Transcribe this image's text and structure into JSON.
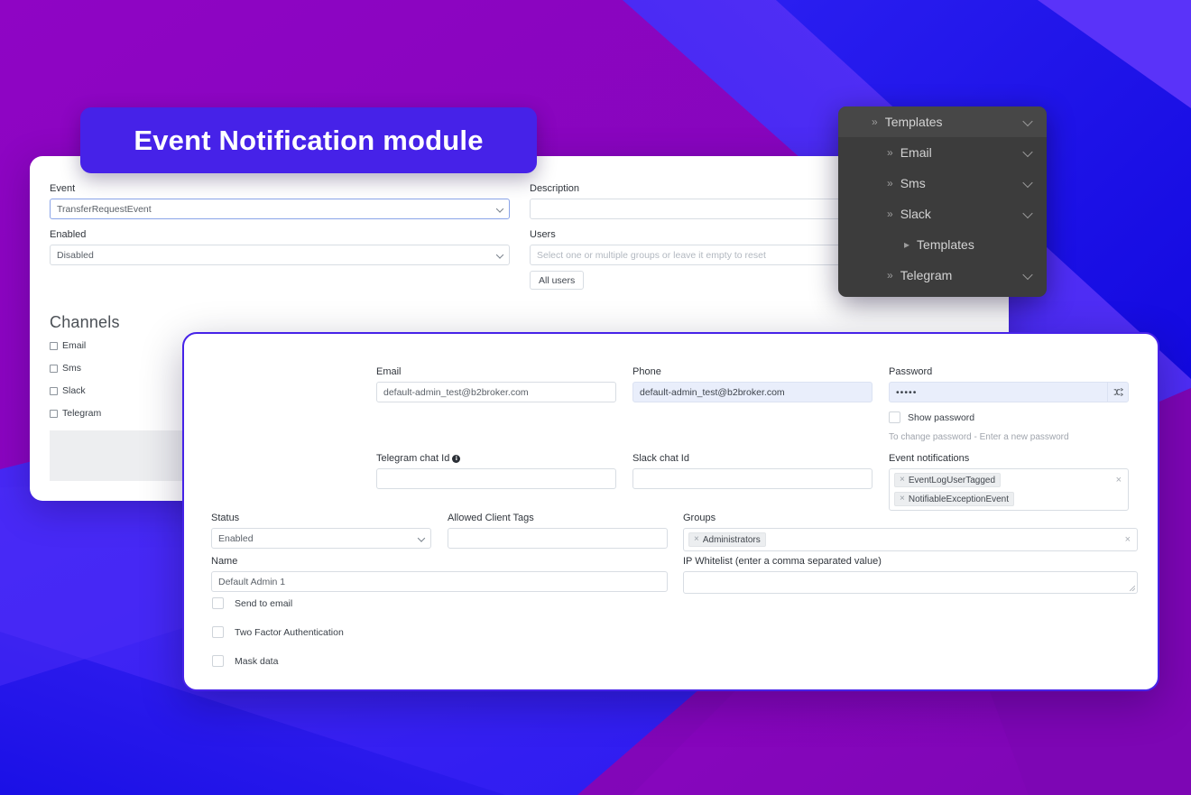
{
  "background": {
    "purple": "#8a06bd",
    "blue_dark": "#1a14e8",
    "blue_mid": "#3a22f0",
    "blue_light": "#5130f5",
    "accent": "#4622e8"
  },
  "title_pill": {
    "text": "Event Notification module"
  },
  "event_card": {
    "event": {
      "label": "Event",
      "value": "TransferRequestEvent"
    },
    "enabled": {
      "label": "Enabled",
      "value": "Disabled"
    },
    "description": {
      "label": "Description",
      "value": ""
    },
    "users": {
      "label": "Users",
      "placeholder": "Select one or multiple groups or leave it empty to reset",
      "all_users_button": "All users"
    },
    "channels": {
      "heading": "Channels",
      "items": [
        {
          "label": "Email",
          "checked": false
        },
        {
          "label": "Sms",
          "checked": false
        },
        {
          "label": "Slack",
          "checked": false
        },
        {
          "label": "Telegram",
          "checked": false
        }
      ]
    }
  },
  "dark_menu": {
    "items": [
      {
        "label": "Templates",
        "level": 0,
        "arrow": "»",
        "chevron": "chevron-down",
        "active": true
      },
      {
        "label": "Email",
        "level": 1,
        "arrow": "»",
        "chevron": "chevron-down",
        "active": false
      },
      {
        "label": "Sms",
        "level": 1,
        "arrow": "»",
        "chevron": "chevron-down",
        "active": false
      },
      {
        "label": "Slack",
        "level": 1,
        "arrow": "»",
        "chevron": "chevron-down",
        "active": false
      },
      {
        "label": "Templates",
        "level": 2,
        "arrow": "▸",
        "chevron": "",
        "active": false
      },
      {
        "label": "Telegram",
        "level": 1,
        "arrow": "»",
        "chevron": "chevron-down",
        "active": false
      }
    ]
  },
  "admin_card": {
    "email": {
      "label": "Email",
      "value": "default-admin_test@b2broker.com"
    },
    "phone": {
      "label": "Phone",
      "value": "default-admin_test@b2broker.com"
    },
    "password": {
      "label": "Password",
      "value": "•••••",
      "generate_icon": "shuffle-icon"
    },
    "show_password": {
      "label": "Show password",
      "checked": false
    },
    "password_hint": "To change password - Enter a new password",
    "telegram_chat_id": {
      "label": "Telegram chat Id",
      "value": "",
      "info_icon": "info-icon"
    },
    "slack_chat_id": {
      "label": "Slack chat Id",
      "value": ""
    },
    "event_notifications": {
      "label": "Event notifications",
      "tags": [
        "EventLogUserTagged",
        "NotifiableExceptionEvent"
      ]
    },
    "status": {
      "label": "Status",
      "value": "Enabled"
    },
    "allowed_client_tags": {
      "label": "Allowed Client Tags",
      "value": ""
    },
    "groups": {
      "label": "Groups",
      "tags": [
        "Administrators"
      ]
    },
    "name": {
      "label": "Name",
      "value": "Default Admin 1"
    },
    "ip_whitelist": {
      "label": "IP Whitelist (enter a comma separated value)",
      "value": ""
    },
    "checkboxes": [
      {
        "label": "Send to email",
        "checked": false
      },
      {
        "label": "Two Factor Authentication",
        "checked": false
      },
      {
        "label": "Mask data",
        "checked": false
      }
    ]
  }
}
